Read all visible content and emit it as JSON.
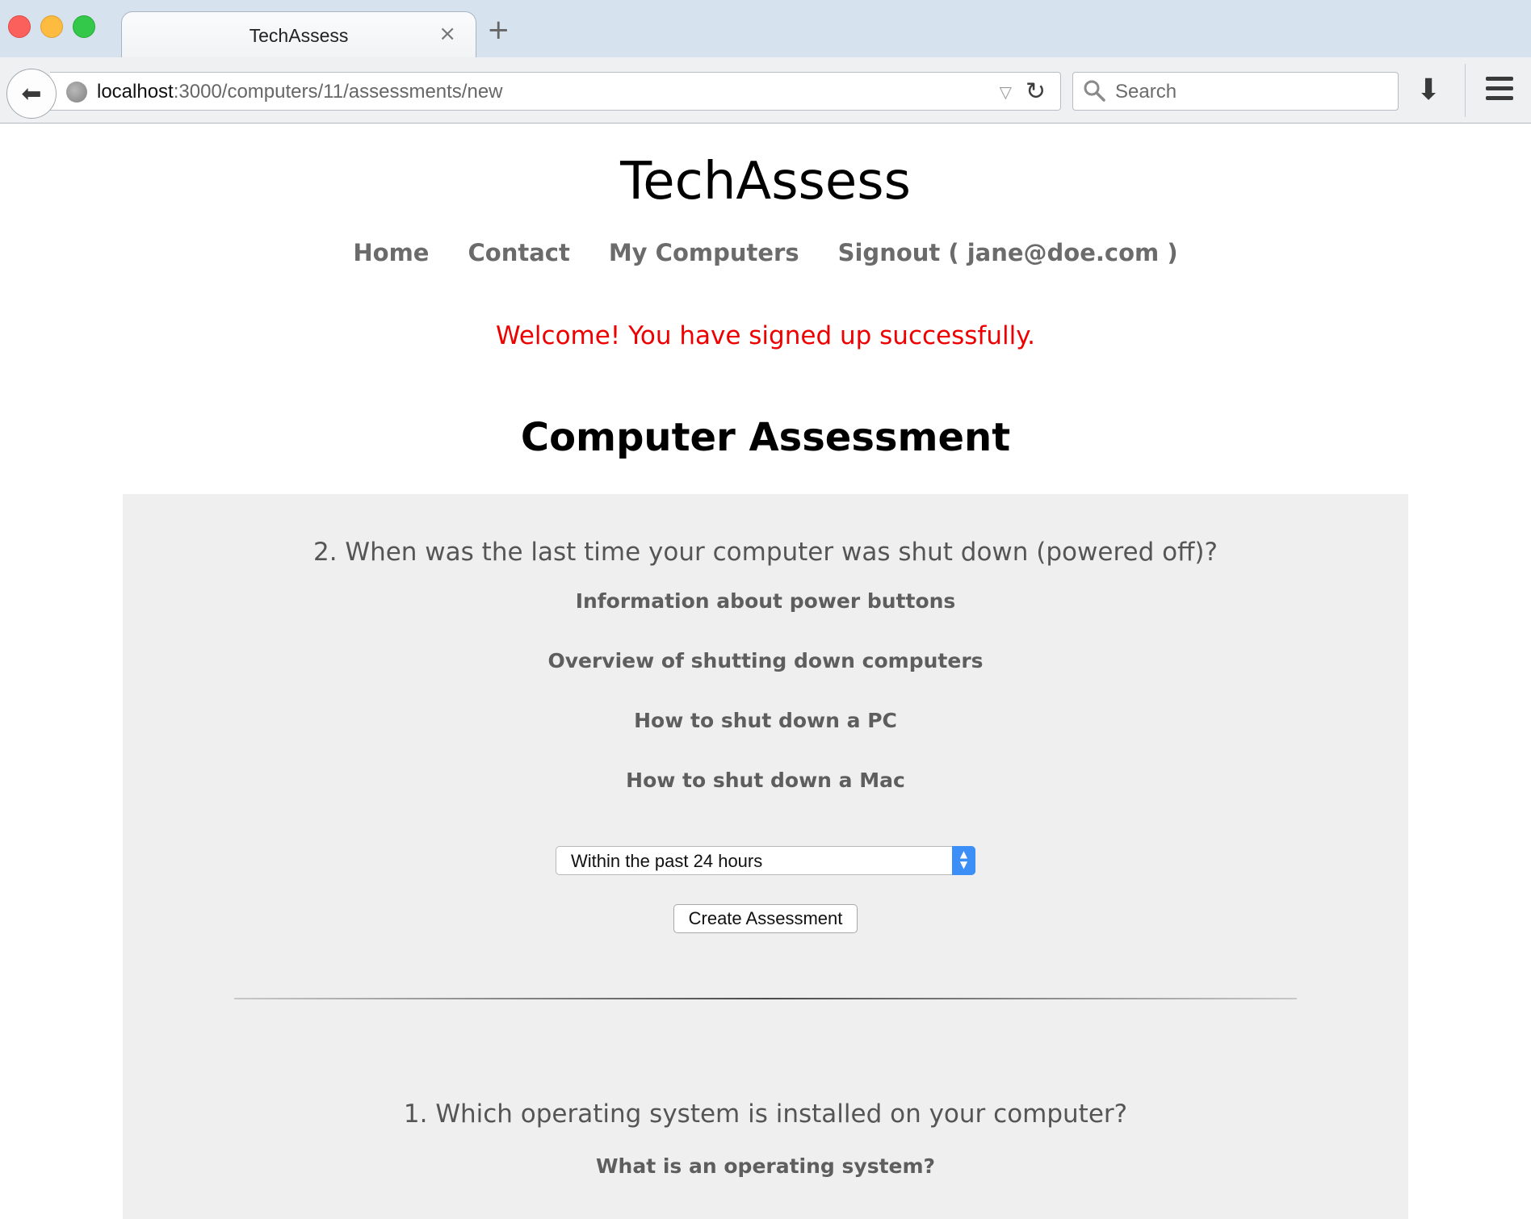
{
  "browser": {
    "tab_title": "TechAssess",
    "tab_close": "×",
    "new_tab": "+",
    "url_host": "localhost",
    "url_path": ":3000/computers/11/assessments/new",
    "search_placeholder": "Search"
  },
  "site": {
    "title": "TechAssess",
    "nav": [
      {
        "label": "Home"
      },
      {
        "label": "Contact"
      },
      {
        "label": "My Computers"
      },
      {
        "label": "Signout ( jane@doe.com )"
      }
    ],
    "flash": "Welcome! You have signed up successfully."
  },
  "assessment": {
    "heading": "Computer Assessment",
    "questions": [
      {
        "title": "2. When was the last time your computer was shut down (powered off)?",
        "links": [
          "Information about power buttons",
          "Overview of shutting down computers",
          "How to shut down a PC",
          "How to shut down a Mac"
        ],
        "selected_answer": "Within the past 24 hours",
        "submit_label": "Create Assessment"
      },
      {
        "title": "1. Which operating system is installed on your computer?",
        "links": [
          "What is an operating system?"
        ]
      }
    ]
  },
  "colors": {
    "flash": "#ee0000",
    "panel_background": "#efefef",
    "select_accent": "#3b8ff6"
  }
}
